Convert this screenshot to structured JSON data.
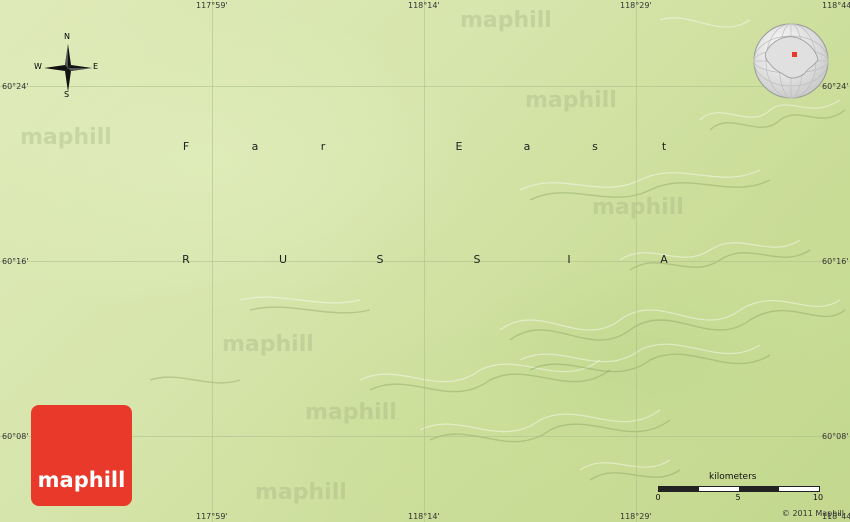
{
  "map": {
    "top_longitudes": [
      "117°59'",
      "118°14'",
      "118°29'",
      "118°44'"
    ],
    "bottom_longitudes": [
      "117°59'",
      "118°14'",
      "118°29'",
      "118°44'"
    ],
    "left_latitudes": [
      "60°24'",
      "60°16'",
      "60°08'"
    ],
    "right_latitudes": [
      "60°24'",
      "60°16'",
      "60°08'"
    ],
    "region_label": [
      "F",
      "a",
      "r",
      "E",
      "a",
      "s",
      "t"
    ],
    "country_label": [
      "R",
      "U",
      "S",
      "S",
      "I",
      "A"
    ],
    "watermark": "maphill",
    "compass": {
      "n": "N",
      "s": "S",
      "e": "E",
      "w": "W"
    },
    "logo_text": "maphill",
    "logo_color": "#e8392b",
    "locator_marker_color": "#e8392b",
    "scale": {
      "title": "kilometers",
      "ticks": [
        "0",
        "5",
        "10"
      ]
    },
    "copyright": "© 2011 Maphill"
  }
}
